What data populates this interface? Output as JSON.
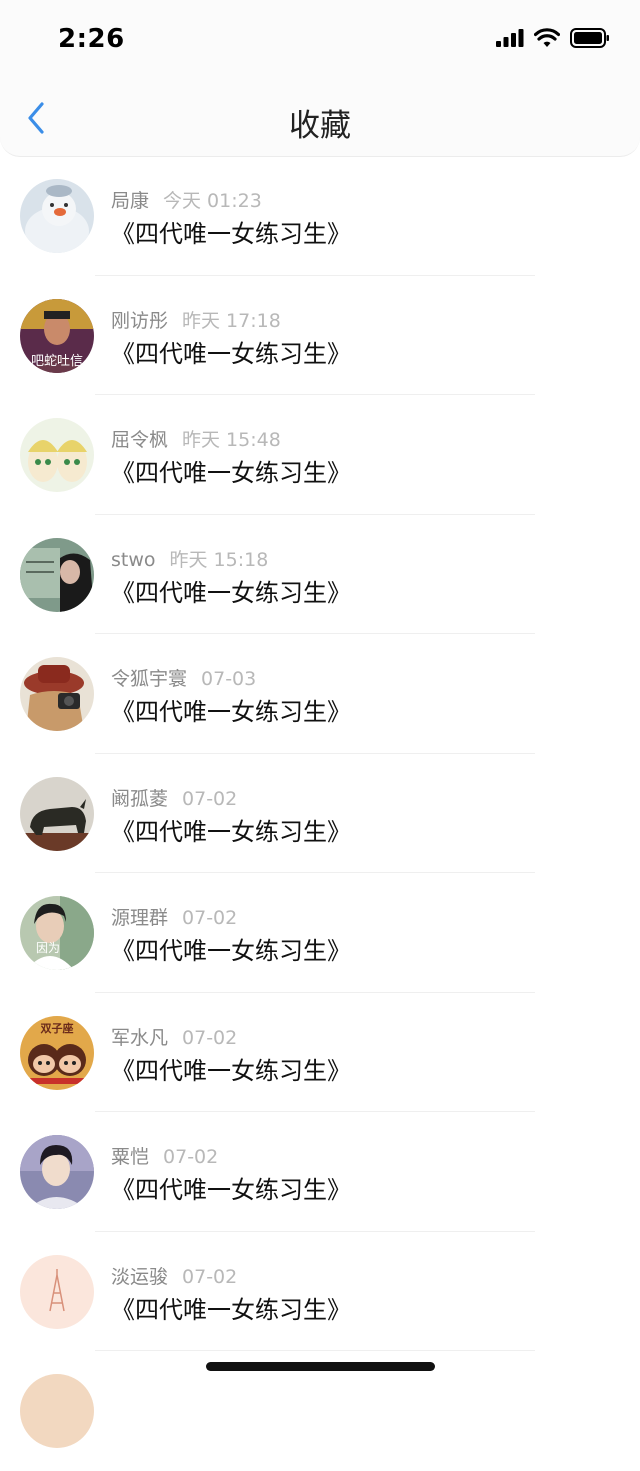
{
  "status_bar": {
    "time": "2:26"
  },
  "nav": {
    "title": "收藏",
    "back_icon": "chevron-left-icon",
    "accent": "#3b8ee8"
  },
  "items": [
    {
      "name": "局康",
      "time": "今天 01:23",
      "title": "《四代唯一女练习生》"
    },
    {
      "name": "刚访彤",
      "time": "昨天 17:18",
      "title": "《四代唯一女练习生》",
      "avatar_text": "吧蛇吐信"
    },
    {
      "name": "屈令枫",
      "time": "昨天 15:48",
      "title": "《四代唯一女练习生》"
    },
    {
      "name": "stwo",
      "time": "昨天 15:18",
      "title": "《四代唯一女练习生》"
    },
    {
      "name": "令狐宇寰",
      "time": "07-03",
      "title": "《四代唯一女练习生》"
    },
    {
      "name": "阚孤菱",
      "time": "07-02",
      "title": "《四代唯一女练习生》"
    },
    {
      "name": "源理群",
      "time": "07-02",
      "title": "《四代唯一女练习生》",
      "avatar_text": "因为"
    },
    {
      "name": "军水凡",
      "time": "07-02",
      "title": "《四代唯一女练习生》",
      "avatar_text": "双子座"
    },
    {
      "name": "粟恺",
      "time": "07-02",
      "title": "《四代唯一女练习生》"
    },
    {
      "name": "淡运骏",
      "time": "07-02",
      "title": "《四代唯一女练习生》"
    },
    {
      "name": "",
      "time": "",
      "title": ""
    }
  ]
}
